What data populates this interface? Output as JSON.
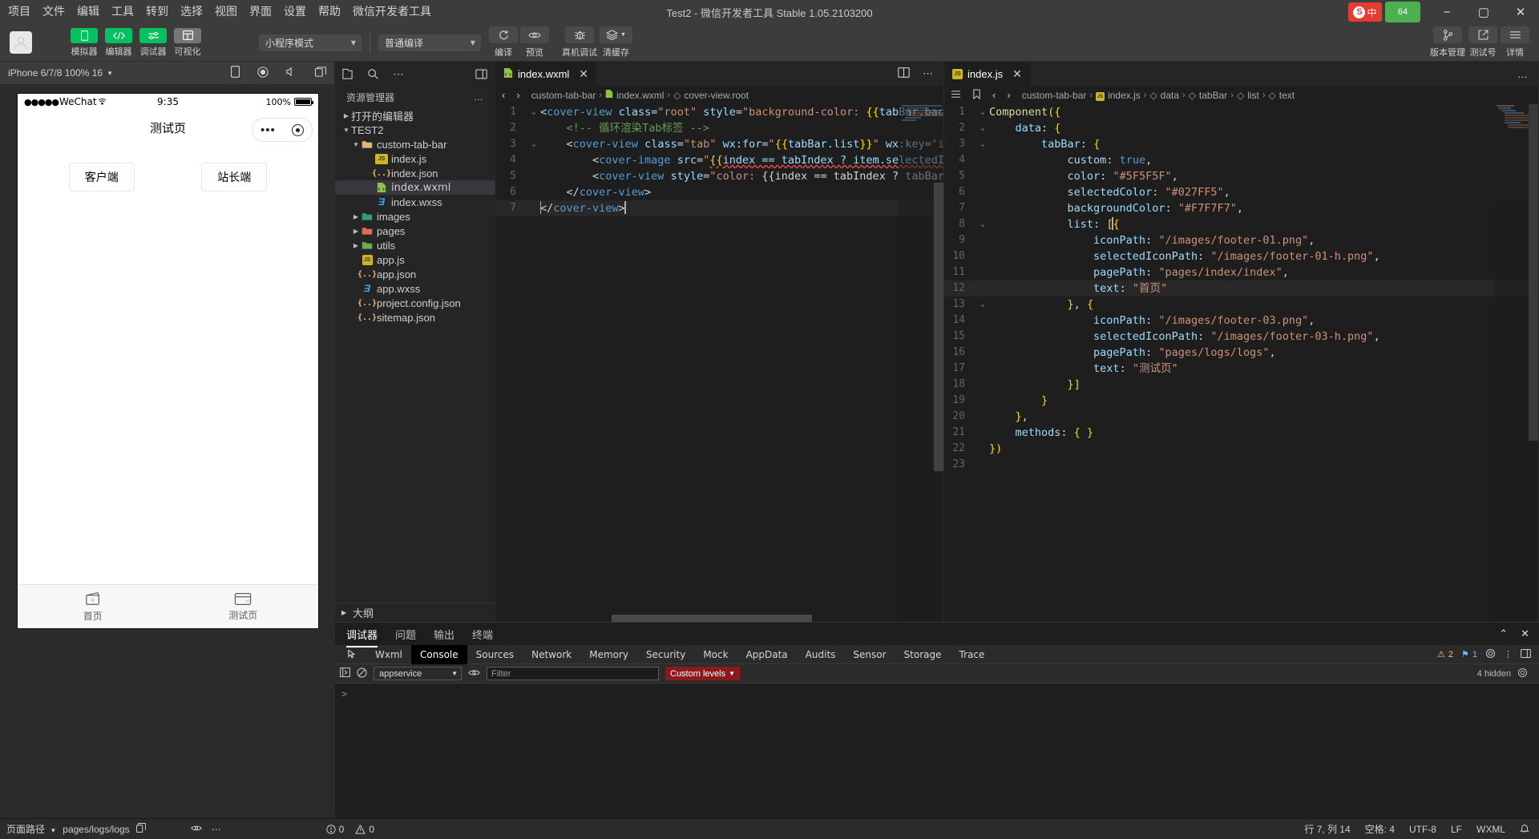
{
  "titlebar": {
    "menus": [
      "项目",
      "文件",
      "编辑",
      "工具",
      "转到",
      "选择",
      "视图",
      "界面",
      "设置",
      "帮助",
      "微信开发者工具"
    ],
    "window_title": "Test2 - 微信开发者工具 Stable 1.05.2103200",
    "tray_sogou": "中",
    "tray_badge": "64",
    "minimize": "−",
    "maximize": "▢",
    "close": "✕"
  },
  "toolbar": {
    "tools": [
      {
        "label": "模拟器",
        "icon": "phone-icon",
        "state": "green"
      },
      {
        "label": "编辑器",
        "icon": "code-icon",
        "state": "green"
      },
      {
        "label": "调试器",
        "icon": "sliders-icon",
        "state": "green"
      },
      {
        "label": "可视化",
        "icon": "layout-icon",
        "state": "grey"
      }
    ],
    "mode_select": "小程序模式",
    "compile_select": "普通编译",
    "actions": [
      {
        "label": "编译",
        "icon": "refresh-icon"
      },
      {
        "label": "预览",
        "icon": "eye-icon"
      },
      {
        "label": "真机调试",
        "icon": "bug-icon"
      },
      {
        "label": "清缓存",
        "icon": "layers-icon"
      }
    ],
    "right_actions": [
      {
        "label": "版本管理",
        "icon": "git-branch-icon"
      },
      {
        "label": "测试号",
        "icon": "external-link-icon"
      },
      {
        "label": "详情",
        "icon": "menu-icon"
      }
    ]
  },
  "simulator": {
    "device": "iPhone 6/7/8 100% 16",
    "icons": [
      "rotate-device-icon",
      "record-icon",
      "mute-icon",
      "copy-icon"
    ],
    "phone": {
      "carrier": "WeChat",
      "carrier_dots": "●●●●●",
      "time": "9:35",
      "battery": "100%",
      "nav_title": "测试页",
      "capsule_dots": "•••",
      "buttons": [
        "客户端",
        "站长端"
      ],
      "tabbar": [
        {
          "text": "首页",
          "icon": "wallet-icon"
        },
        {
          "text": "测试页",
          "icon": "card-icon"
        }
      ]
    }
  },
  "explorer": {
    "toolbar_icons": [
      "files-icon",
      "search-icon",
      "more-icon",
      "collapse-icon"
    ],
    "title": "资源管理器",
    "more": "…",
    "sections": [
      {
        "label": "打开的编辑器",
        "expanded": false
      },
      {
        "label": "TEST2",
        "expanded": true
      }
    ],
    "tree": [
      {
        "label": "custom-tab-bar",
        "type": "folder",
        "depth": 1,
        "expanded": true,
        "color": "#dcb67a"
      },
      {
        "label": "index.js",
        "type": "js",
        "depth": 2
      },
      {
        "label": "index.json",
        "type": "json",
        "depth": 2
      },
      {
        "label": "index.wxml",
        "type": "wxml",
        "depth": 2,
        "selected": true
      },
      {
        "label": "index.wxss",
        "type": "wxss",
        "depth": 2
      },
      {
        "label": "images",
        "type": "folder",
        "depth": 1,
        "expanded": false,
        "color": "#2e9e7a"
      },
      {
        "label": "pages",
        "type": "folder",
        "depth": 1,
        "expanded": false,
        "color": "#e06c5a"
      },
      {
        "label": "utils",
        "type": "folder",
        "depth": 1,
        "expanded": false,
        "color": "#6aab52"
      },
      {
        "label": "app.js",
        "type": "js",
        "depth": 1
      },
      {
        "label": "app.json",
        "type": "json",
        "depth": 1
      },
      {
        "label": "app.wxss",
        "type": "wxss",
        "depth": 1
      },
      {
        "label": "project.config.json",
        "type": "json",
        "depth": 1
      },
      {
        "label": "sitemap.json",
        "type": "json",
        "depth": 1
      }
    ],
    "outline": "大纲"
  },
  "editor_left": {
    "tab": {
      "label": "index.wxml",
      "icon": "wxml-file-icon",
      "close": "✕"
    },
    "split_icons": [
      "split-editor-icon",
      "more-actions-icon"
    ],
    "nav_back": "‹",
    "nav_fwd": "›",
    "breadcrumb": [
      "custom-tab-bar",
      "index.wxml",
      "cover-view.root"
    ],
    "lines": [
      {
        "n": 1,
        "fold": "v",
        "hl": false
      },
      {
        "n": 2,
        "fold": "",
        "hl": false
      },
      {
        "n": 3,
        "fold": "v",
        "hl": false
      },
      {
        "n": 4,
        "fold": "",
        "hl": false
      },
      {
        "n": 5,
        "fold": "",
        "hl": false
      },
      {
        "n": 6,
        "fold": "",
        "hl": false
      },
      {
        "n": 7,
        "fold": "",
        "hl": true
      }
    ],
    "code_text": [
      "<cover-view class=\"root\" style=\"background-color: {{tabBar.back",
      "    <!-- 循环渲染Tab标签 -->",
      "    <cover-view class=\"tab\" wx:for=\"{{tabBar.list}}\" wx:key=\"in",
      "        <cover-image src=\"{{index == tabIndex ? item.selectedIc",
      "        <cover-view style=\"color: {{index == tabIndex ? tabBar.",
      "    </cover-view>",
      "</cover-view>"
    ]
  },
  "editor_right": {
    "tab": {
      "label": "index.js",
      "icon": "js-file-icon",
      "close": "✕"
    },
    "more": "…",
    "nav_back": "‹",
    "nav_fwd": "›",
    "breadcrumb": [
      "custom-tab-bar",
      "index.js",
      "data",
      "tabBar",
      "list",
      "text"
    ],
    "lines": [
      {
        "n": 1,
        "fold": "v",
        "hl": false
      },
      {
        "n": 2,
        "fold": "v",
        "hl": false
      },
      {
        "n": 3,
        "fold": "v",
        "hl": false
      },
      {
        "n": 4,
        "fold": "",
        "hl": false
      },
      {
        "n": 5,
        "fold": "",
        "hl": false
      },
      {
        "n": 6,
        "fold": "",
        "hl": false
      },
      {
        "n": 7,
        "fold": "",
        "hl": false
      },
      {
        "n": 8,
        "fold": "v",
        "hl": false
      },
      {
        "n": 9,
        "fold": "",
        "hl": false
      },
      {
        "n": 10,
        "fold": "",
        "hl": false
      },
      {
        "n": 11,
        "fold": "",
        "hl": false
      },
      {
        "n": 12,
        "fold": "",
        "hl": true
      },
      {
        "n": 13,
        "fold": "v",
        "hl": false
      },
      {
        "n": 14,
        "fold": "",
        "hl": false
      },
      {
        "n": 15,
        "fold": "",
        "hl": false
      },
      {
        "n": 16,
        "fold": "",
        "hl": false
      },
      {
        "n": 17,
        "fold": "",
        "hl": false
      },
      {
        "n": 18,
        "fold": "",
        "hl": false
      },
      {
        "n": 19,
        "fold": "",
        "hl": false
      },
      {
        "n": 20,
        "fold": "",
        "hl": false
      },
      {
        "n": 21,
        "fold": "",
        "hl": false
      },
      {
        "n": 22,
        "fold": "",
        "hl": false
      },
      {
        "n": 23,
        "fold": "",
        "hl": false
      }
    ],
    "code_text": [
      "Component({",
      "    data: {",
      "        tabBar: {",
      "            custom: true,",
      "            color: \"#5F5F5F\",",
      "            selectedColor: \"#027FF5\",",
      "            backgroundColor: \"#F7F7F7\",",
      "            list: [{",
      "                iconPath: \"/images/footer-01.png\",",
      "                selectedIconPath: \"/images/footer-01-h.png\",",
      "                pagePath: \"pages/index/index\",",
      "                text: \"首页\"",
      "            }, {",
      "                iconPath: \"/images/footer-03.png\",",
      "                selectedIconPath: \"/images/footer-03-h.png\",",
      "                pagePath: \"pages/logs/logs\",",
      "                text: \"测试页\"",
      "            }]",
      "        }",
      "    },",
      "    methods: { }",
      "})",
      ""
    ]
  },
  "console": {
    "panel_tabs": [
      "调试器",
      "问题",
      "输出",
      "终端"
    ],
    "panel_tab_active": "调试器",
    "panel_right_icons": [
      "chevron-up-icon",
      "close-icon"
    ],
    "devtools_tabs": [
      "Wxml",
      "Console",
      "Sources",
      "Network",
      "Memory",
      "Security",
      "Mock",
      "AppData",
      "Audits",
      "Sensor",
      "Storage",
      "Trace"
    ],
    "devtools_active": "Console",
    "inspect_icon": "inspect-icon",
    "warn_count": "2",
    "err_count": "1",
    "settings_icons": [
      "settings-gear-icon",
      "kebab-icon",
      "dock-icon"
    ],
    "context_select": "appservice",
    "eye_icon": "eye-icon",
    "filter_placeholder": "Filter",
    "level_select": "Custom levels",
    "hidden_count": "4 hidden",
    "prompt": ">"
  },
  "statusbar": {
    "page_path_label": "页面路径",
    "page_path_value": "pages/logs/logs",
    "copy_icon": "copy-icon",
    "eye_icon": "eye-icon",
    "more_icon": "more-icon",
    "errors": "0",
    "warnings": "0",
    "cursor": "行 7, 列 14",
    "spaces": "空格: 4",
    "encoding": "UTF-8",
    "eol": "LF",
    "language": "WXML",
    "bell_icon": "bell-icon"
  }
}
